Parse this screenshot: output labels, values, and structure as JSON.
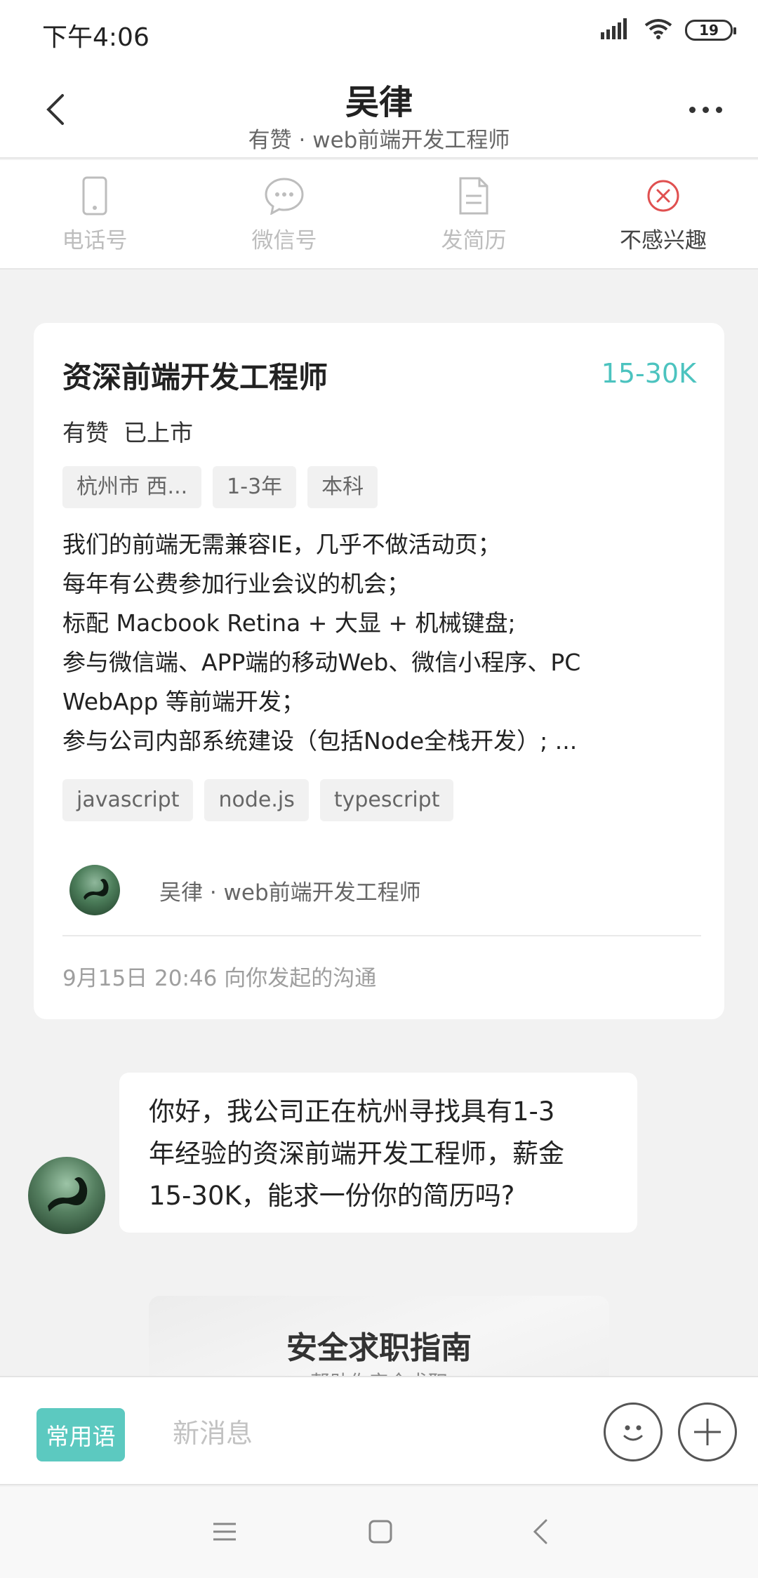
{
  "status_bar": {
    "time": "下午4:06",
    "battery": "19",
    "icons": [
      "signal-icon",
      "wifi-icon",
      "battery-icon"
    ]
  },
  "header": {
    "title": "吴律",
    "subtitle": "有赞 · web前端开发工程师"
  },
  "actions": [
    {
      "label": "电话号",
      "icon": "phone-icon",
      "active": false
    },
    {
      "label": "微信号",
      "icon": "chat-bubble-icon",
      "active": false
    },
    {
      "label": "发简历",
      "icon": "resume-icon",
      "active": false
    },
    {
      "label": "不感兴趣",
      "icon": "close-circle-icon",
      "active": true
    }
  ],
  "job_card": {
    "title": "资深前端开发工程师",
    "salary": "15-30K",
    "company": "有赞  已上市",
    "tags": [
      "杭州市 西...",
      "1-3年",
      "本科"
    ],
    "description": [
      "我们的前端无需兼容IE，几乎不做活动页；",
      "每年有公费参加行业会议的机会；",
      "标配 Macbook Retina + 大显 + 机械键盘;",
      "参与微信端、APP端的移动Web、微信小程序、PC",
      "WebApp 等前端开发；",
      "参与公司内部系统建设（包括Node全栈开发）; ..."
    ],
    "skills": [
      "javascript",
      "node.js",
      "typescript"
    ],
    "recruiter": "吴律 · web前端开发工程师",
    "time": "9月15日 20:46 向你发起的沟通"
  },
  "message": {
    "lines": [
      "你好，我公司正在杭州寻找具有1-3",
      "年经验的资深前端开发工程师，薪金",
      "15-30K，能求一份你的简历吗?"
    ]
  },
  "guide": {
    "title": "安全求职指南",
    "subtitle": "帮助你安全求职"
  },
  "input_bar": {
    "phrases_label": "常用语",
    "placeholder": "新消息"
  },
  "colors": {
    "accent": "#5cc9c0",
    "salary": "#4cc3bf",
    "close": "#e05050"
  }
}
